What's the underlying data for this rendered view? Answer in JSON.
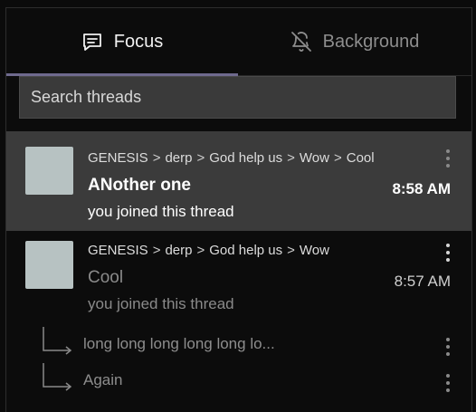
{
  "tabs": [
    {
      "label": "Focus",
      "icon": "message-square-icon",
      "active": true
    },
    {
      "label": "Background",
      "icon": "bell-off-icon",
      "active": false
    }
  ],
  "search": {
    "placeholder": "Search threads",
    "value": ""
  },
  "threads": [
    {
      "breadcrumb": [
        "GENESIS",
        "derp",
        "God help us",
        "Wow",
        "Cool"
      ],
      "title": "ANother one",
      "time": "8:58 AM",
      "status": "you joined this thread",
      "selected": true
    },
    {
      "breadcrumb": [
        "GENESIS",
        "derp",
        "God help us",
        "Wow"
      ],
      "title": "Cool",
      "time": "8:57 AM",
      "status": "you joined this thread",
      "selected": false,
      "subthreads": [
        {
          "title": "long long long long long lo..."
        },
        {
          "title": "Again"
        }
      ]
    }
  ],
  "colors": {
    "accent_underline": "#6f6a8e",
    "selected_row": "#3b3b3b",
    "avatar": "#b7c2c2",
    "background": "#0c0c0c"
  }
}
